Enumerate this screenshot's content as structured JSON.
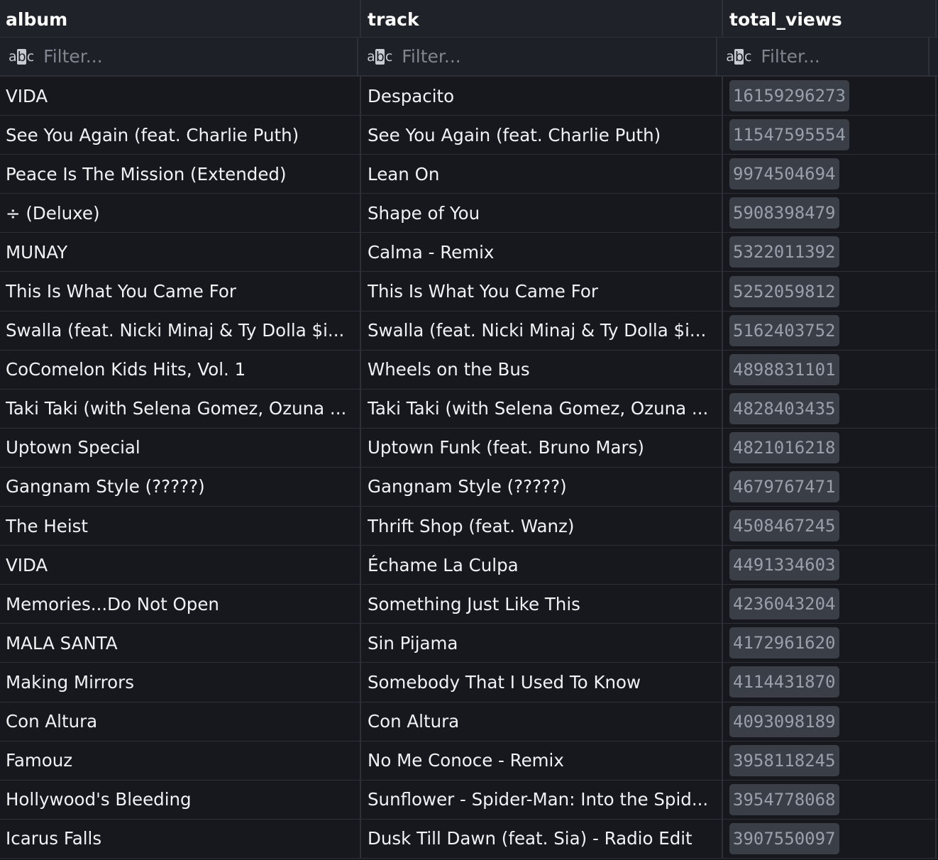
{
  "columns": [
    {
      "name": "album",
      "filter_placeholder": "Filter..."
    },
    {
      "name": "track",
      "filter_placeholder": "Filter..."
    },
    {
      "name": "total_views",
      "filter_placeholder": "Filter..."
    }
  ],
  "filter_icon": "abc-icon",
  "rows": [
    {
      "album": "VIDA",
      "track": "Despacito",
      "total_views": "16159296273"
    },
    {
      "album": "See You Again (feat. Charlie Puth)",
      "track": "See You Again (feat. Charlie Puth)",
      "total_views": "11547595554"
    },
    {
      "album": "Peace Is The Mission (Extended)",
      "track": "Lean On",
      "total_views": "9974504694"
    },
    {
      "album": "÷ (Deluxe)",
      "track": "Shape of You",
      "total_views": "5908398479"
    },
    {
      "album": "MUNAY",
      "track": "Calma - Remix",
      "total_views": "5322011392"
    },
    {
      "album": "This Is What You Came For",
      "track": "This Is What You Came For",
      "total_views": "5252059812"
    },
    {
      "album": "Swalla (feat. Nicki Minaj & Ty Dolla $i...",
      "track": "Swalla (feat. Nicki Minaj & Ty Dolla $i...",
      "total_views": "5162403752"
    },
    {
      "album": "CoComelon Kids Hits, Vol. 1",
      "track": "Wheels on the Bus",
      "total_views": "4898831101"
    },
    {
      "album": "Taki Taki (with Selena Gomez, Ozuna ...",
      "track": "Taki Taki (with Selena Gomez, Ozuna ...",
      "total_views": "4828403435"
    },
    {
      "album": "Uptown Special",
      "track": "Uptown Funk (feat. Bruno Mars)",
      "total_views": "4821016218"
    },
    {
      "album": "Gangnam Style (?????)",
      "track": "Gangnam Style (?????)",
      "total_views": "4679767471"
    },
    {
      "album": "The Heist",
      "track": "Thrift Shop (feat. Wanz)",
      "total_views": "4508467245"
    },
    {
      "album": "VIDA",
      "track": "Échame La Culpa",
      "total_views": "4491334603"
    },
    {
      "album": "Memories...Do Not Open",
      "track": "Something Just Like This",
      "total_views": "4236043204"
    },
    {
      "album": "MALA SANTA",
      "track": "Sin Pijama",
      "total_views": "4172961620"
    },
    {
      "album": "Making Mirrors",
      "track": "Somebody That I Used To Know",
      "total_views": "4114431870"
    },
    {
      "album": "Con Altura",
      "track": "Con Altura",
      "total_views": "4093098189"
    },
    {
      "album": "Famouz",
      "track": "No Me Conoce - Remix",
      "total_views": "3958118245"
    },
    {
      "album": "Hollywood's Bleeding",
      "track": "Sunflower - Spider-Man: Into the Spid...",
      "total_views": "3954778068"
    },
    {
      "album": "Icarus Falls",
      "track": "Dusk Till Dawn (feat. Sia) - Radio Edit",
      "total_views": "3907550097"
    }
  ]
}
